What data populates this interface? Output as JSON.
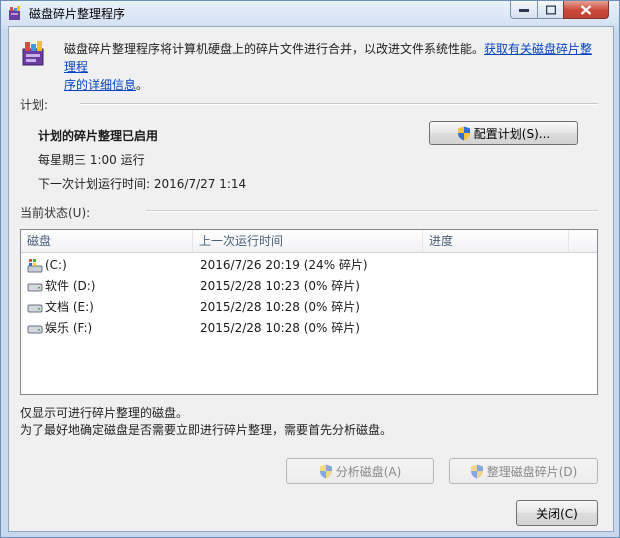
{
  "window": {
    "title": "磁盘碎片整理程序"
  },
  "header": {
    "description": "磁盘碎片整理程序将计算机硬盘上的碎片文件进行合并，以改进文件系统性能。",
    "link_part1": "获取有关磁盘碎片整理程",
    "link_part2": "序的详细信息",
    "link_suffix": "。"
  },
  "schedule": {
    "label": "计划:",
    "status": "计划的碎片整理已启用",
    "frequency": "每星期三  1:00 运行",
    "next_run": "下一次计划运行时间: 2016/7/27 1:14",
    "configure_button": "配置计划(S)..."
  },
  "current_status": {
    "label": "当前状态(U):",
    "columns": [
      "磁盘",
      "上一次运行时间",
      "进度"
    ],
    "rows": [
      {
        "disk": "(C:)",
        "last_run": "2016/7/26 20:19 (24% 碎片)",
        "progress": "",
        "icon": "system-drive-icon"
      },
      {
        "disk": "软件 (D:)",
        "last_run": "2015/2/28 10:23 (0% 碎片)",
        "progress": "",
        "icon": "hard-drive-icon"
      },
      {
        "disk": "文档 (E:)",
        "last_run": "2015/2/28 10:28 (0% 碎片)",
        "progress": "",
        "icon": "hard-drive-icon"
      },
      {
        "disk": "娱乐 (F:)",
        "last_run": "2015/2/28 10:28 (0% 碎片)",
        "progress": "",
        "icon": "hard-drive-icon"
      }
    ]
  },
  "notes": {
    "line1": "仅显示可进行碎片整理的磁盘。",
    "line2": "为了最好地确定磁盘是否需要立即进行碎片整理，需要首先分析磁盘。"
  },
  "actions": {
    "analyze_button": "分析磁盘(A)",
    "defrag_button": "整理磁盘碎片(D)",
    "close_button": "关闭(C)"
  },
  "colors": {
    "link": "#0645c2",
    "close_caption": "#c9483a"
  }
}
